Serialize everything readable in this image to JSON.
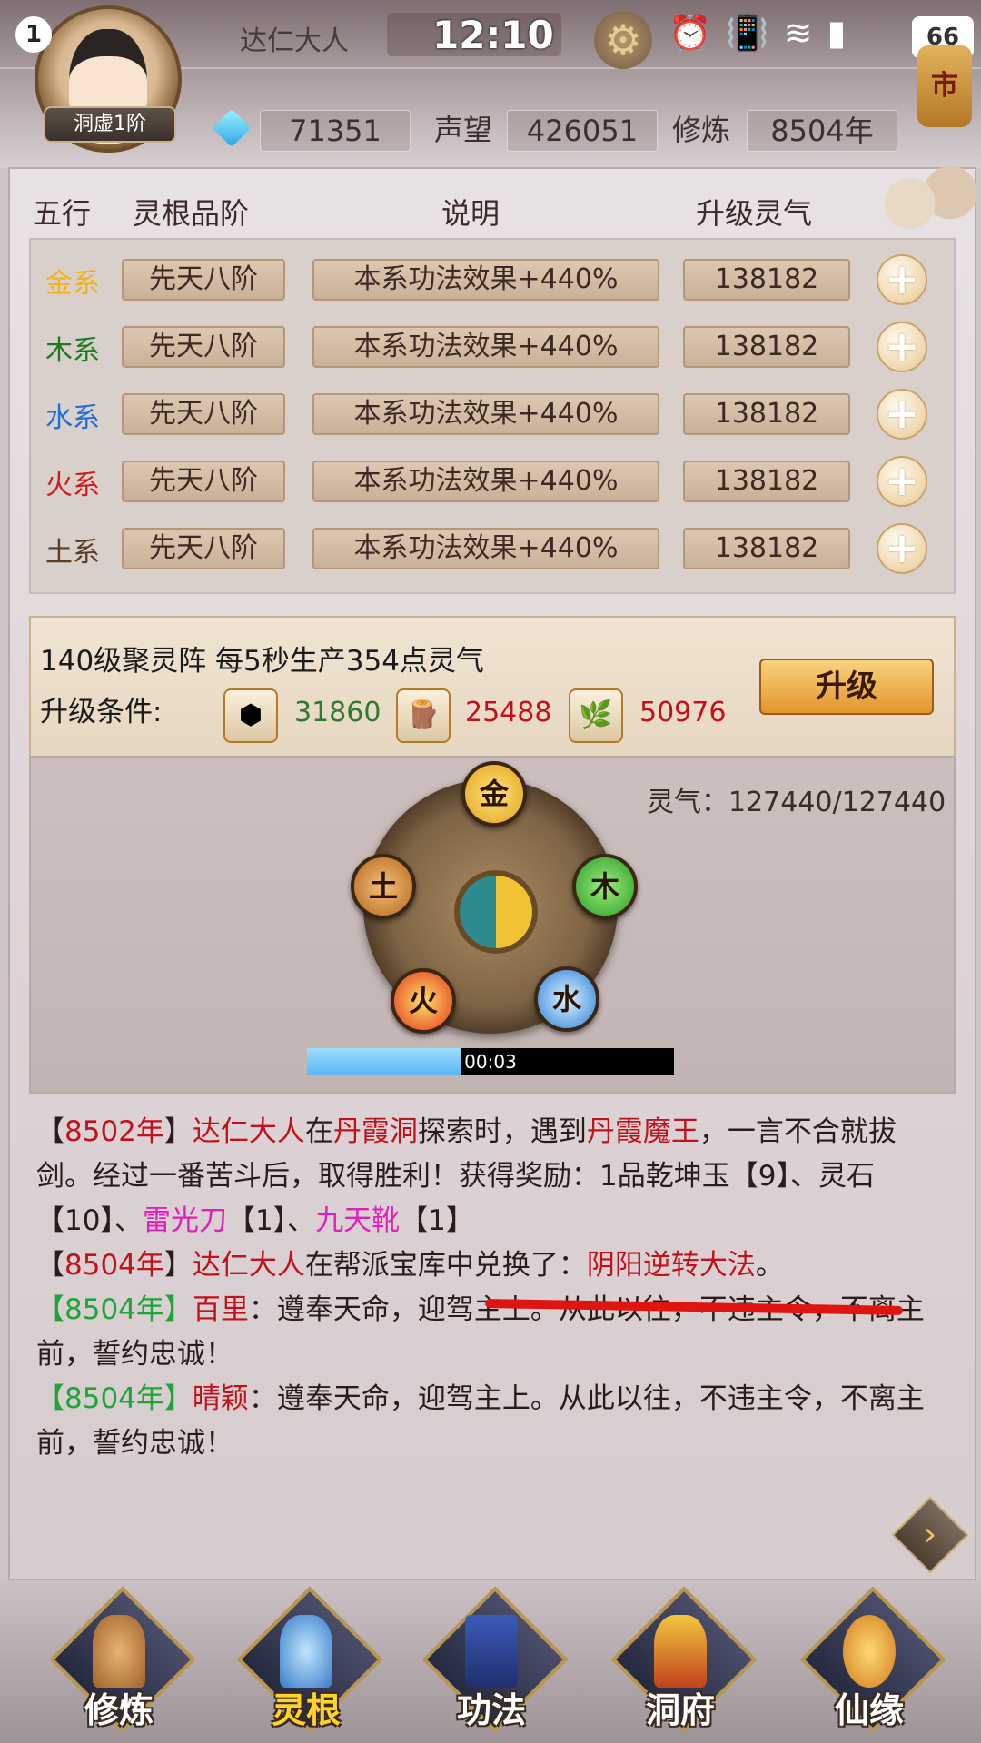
{
  "status_bar": {
    "notification_count": "1",
    "time": "12:10",
    "battery": "66"
  },
  "player": {
    "name": "达仁大人",
    "realm": "洞虚1阶",
    "gems": "71351",
    "reputation_label": "声望",
    "reputation": "426051",
    "cultivation_label": "修炼",
    "cultivation": "8504年"
  },
  "market_label": "市",
  "table": {
    "headers": [
      "五行",
      "灵根品阶",
      "说明",
      "升级灵气"
    ],
    "rows": [
      {
        "element": "金系",
        "color": "#f2b21b",
        "grade": "先天八阶",
        "effect": "本系功法效果+440%",
        "cost": "138182"
      },
      {
        "element": "木系",
        "color": "#1e7a1e",
        "grade": "先天八阶",
        "effect": "本系功法效果+440%",
        "cost": "138182"
      },
      {
        "element": "水系",
        "color": "#1c6fd6",
        "grade": "先天八阶",
        "effect": "本系功法效果+440%",
        "cost": "138182"
      },
      {
        "element": "火系",
        "color": "#d11a1a",
        "grade": "先天八阶",
        "effect": "本系功法效果+440%",
        "cost": "138182"
      },
      {
        "element": "土系",
        "color": "#5b3b22",
        "grade": "先天八阶",
        "effect": "本系功法效果+440%",
        "cost": "138182"
      }
    ]
  },
  "spirit_array": {
    "title": "140级聚灵阵   每5秒生产354点灵气",
    "condition_label": "升级条件:",
    "resources": [
      {
        "icon": "stone-icon",
        "amount": "31860",
        "color": "#2f7a2f"
      },
      {
        "icon": "wood-icon",
        "amount": "25488",
        "color": "#c0121a"
      },
      {
        "icon": "herb-icon",
        "amount": "50976",
        "color": "#c0121a"
      }
    ],
    "upgrade_label": "升级"
  },
  "wheel": {
    "qi": "灵气：127440/127440",
    "elements": [
      "金",
      "木",
      "水",
      "火",
      "土"
    ],
    "timer": "00:03",
    "progress": 0.42
  },
  "log": {
    "e1_year": "8502年",
    "e1_name": "达仁大人",
    "e1_t1": "在",
    "e1_place": "丹霞洞",
    "e1_t2": "探索时，遇到",
    "e1_boss": "丹霞魔王",
    "e1_t3": "，一言不合就拔剑。经过一番苦斗后，取得胜利！获得奖励：1品乾坤玉【9】、灵石【10】、",
    "e1_item1": "雷光刀",
    "e1_t4": "【1】、",
    "e1_item2": "九天靴",
    "e1_t5": "【1】",
    "e2_year": "8504年",
    "e2_name": "达仁大人",
    "e2_t1": "在帮派宝库中兑换了：",
    "e2_item": "阴阳逆转大法",
    "e2_t2": "。",
    "e3_year": "8504年",
    "e3_name": "百里",
    "e3_text": "：遵奉天命，迎驾主上。从此以往，不违主令，不离主前，誓约忠诚！",
    "e4_year": "8504年",
    "e4_name": "晴颖",
    "e4_text": "：遵奉天命，迎驾主上。从此以往，不违主令，不离主前，誓约忠诚！",
    "bracket_open": "【",
    "bracket_close": "】"
  },
  "nav": [
    "修炼",
    "灵根",
    "功法",
    "洞府",
    "仙缘"
  ],
  "nav_active_index": 1
}
